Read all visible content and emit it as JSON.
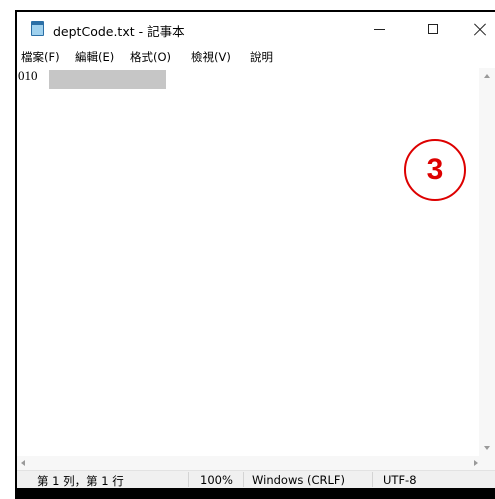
{
  "window": {
    "title": "deptCode.txt - 記事本",
    "icon": "notepad-icon"
  },
  "menu": {
    "items": [
      "檔案(F)",
      "編輯(E)",
      "格式(O)",
      "檢視(V)",
      "說明"
    ]
  },
  "editor": {
    "text": "010"
  },
  "annotation": {
    "number": "3",
    "color": "#dd0000"
  },
  "status": {
    "position": "第 1 列，第 1 行",
    "zoom": "100%",
    "line_ending": "Windows (CRLF)",
    "encoding": "UTF-8"
  }
}
